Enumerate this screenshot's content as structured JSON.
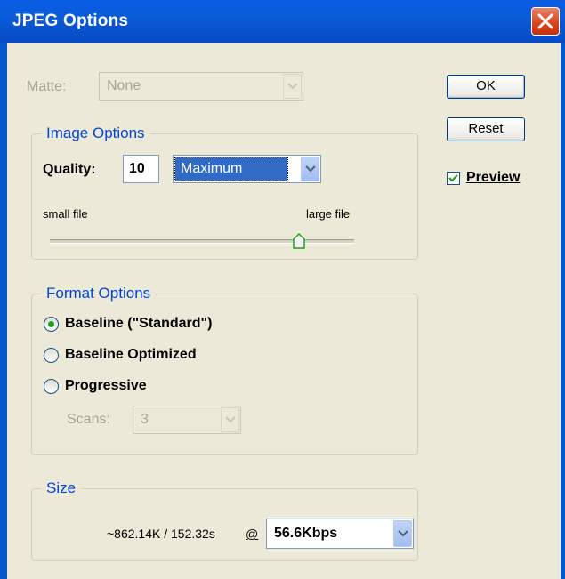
{
  "window": {
    "title": "JPEG Options"
  },
  "matte": {
    "label": "Matte:",
    "value": "None"
  },
  "buttons": {
    "ok": "OK",
    "reset": "Reset"
  },
  "preview": {
    "label": "Preview",
    "checked": true
  },
  "image_options": {
    "group_title": "Image Options",
    "quality_label": "Quality:",
    "quality_value": "10",
    "quality_preset": "Maximum",
    "slider_min_label": "small file",
    "slider_max_label": "large file",
    "slider_level": 10,
    "slider_max": 12
  },
  "format_options": {
    "group_title": "Format Options",
    "options": [
      {
        "label": "Baseline (\"Standard\")",
        "selected": true
      },
      {
        "label": "Baseline Optimized",
        "selected": false
      },
      {
        "label": "Progressive",
        "selected": false
      }
    ],
    "scans_label": "Scans:",
    "scans_value": "3"
  },
  "size": {
    "group_title": "Size",
    "estimate": "~862.14K / 152.32s",
    "at_label": "@",
    "connection": "56.6Kbps"
  }
}
